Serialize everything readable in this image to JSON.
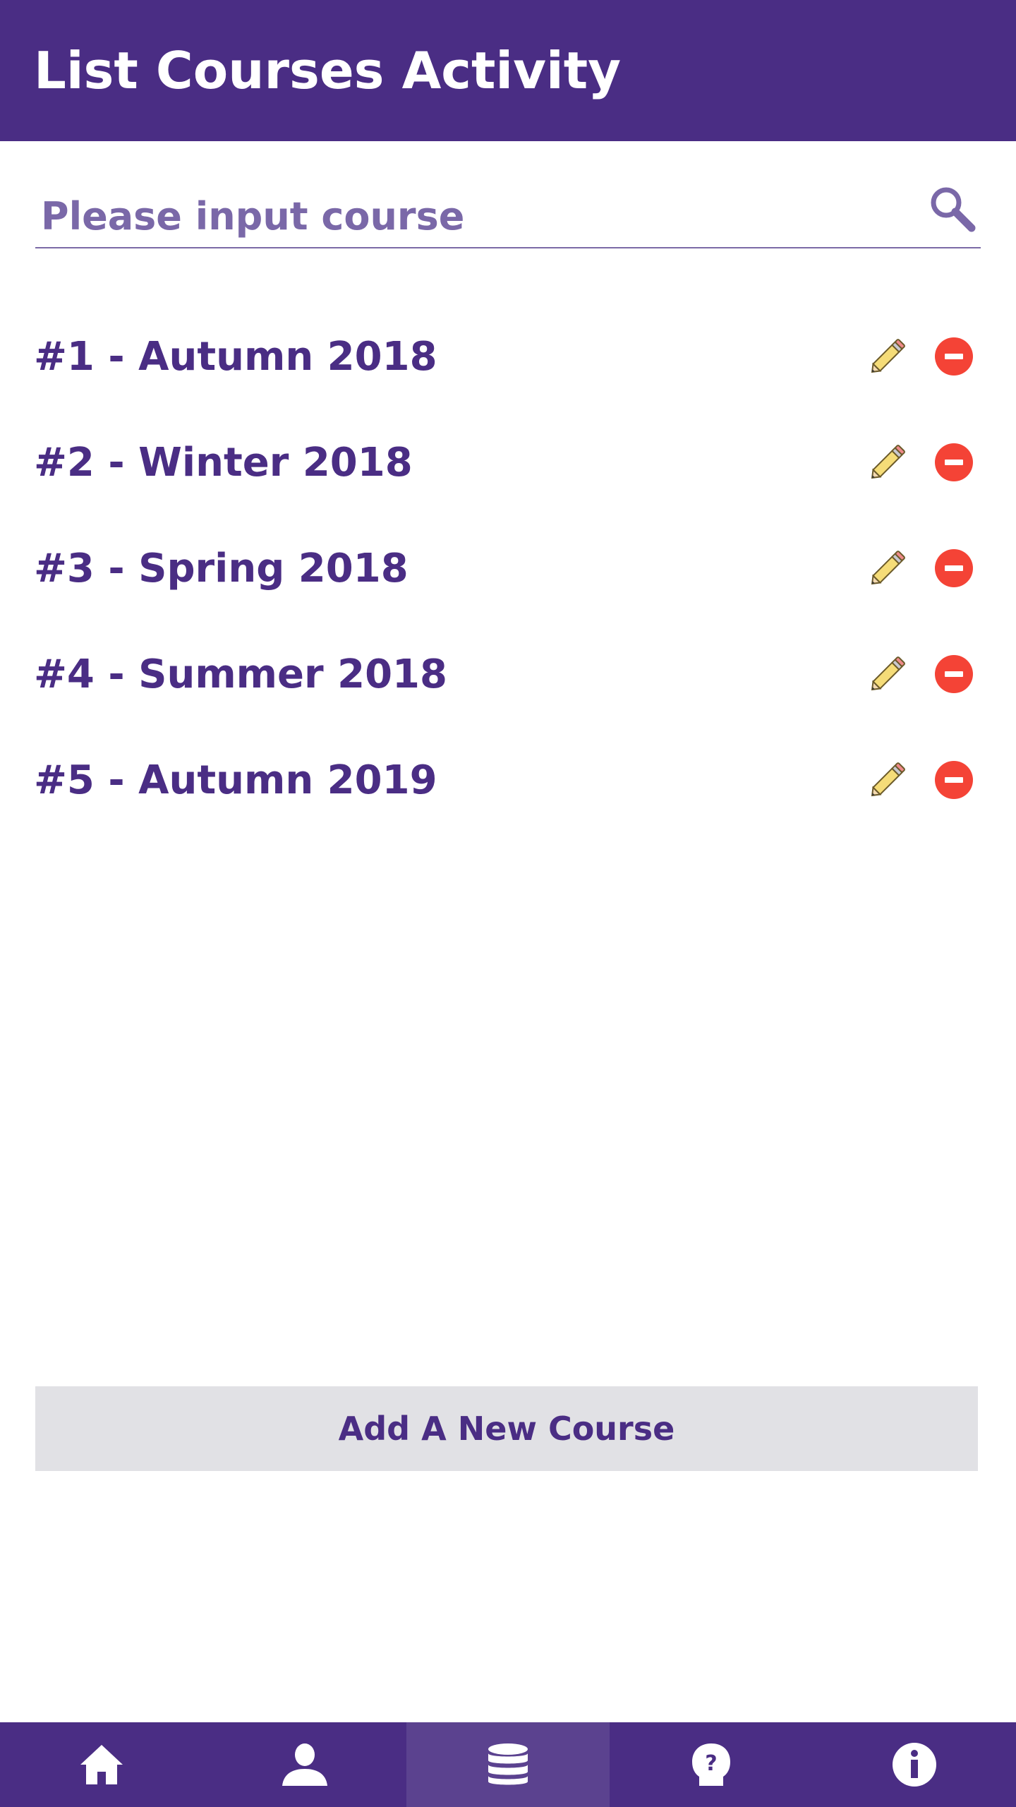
{
  "header": {
    "title": "List Courses Activity"
  },
  "search": {
    "placeholder": "Please input course",
    "value": "",
    "icon": "search-icon"
  },
  "courses": [
    {
      "label": "#1 - Autumn 2018"
    },
    {
      "label": "#2 - Winter 2018"
    },
    {
      "label": "#3 - Spring 2018"
    },
    {
      "label": "#4 - Summer 2018"
    },
    {
      "label": "#5 - Autumn 2019"
    }
  ],
  "actions": {
    "add_course_label": "Add A New Course"
  },
  "bottom_nav": {
    "items": [
      {
        "icon": "home-icon",
        "active": false
      },
      {
        "icon": "user-icon",
        "active": false
      },
      {
        "icon": "database-icon",
        "active": true
      },
      {
        "icon": "help-icon",
        "active": false
      },
      {
        "icon": "info-icon",
        "active": false
      }
    ]
  },
  "colors": {
    "primary": "#4a2d84",
    "nav_active": "#5b428f",
    "button_bg": "#e1e1e5",
    "delete_red": "#f44336",
    "pencil_yellow": "#f5dc78"
  }
}
